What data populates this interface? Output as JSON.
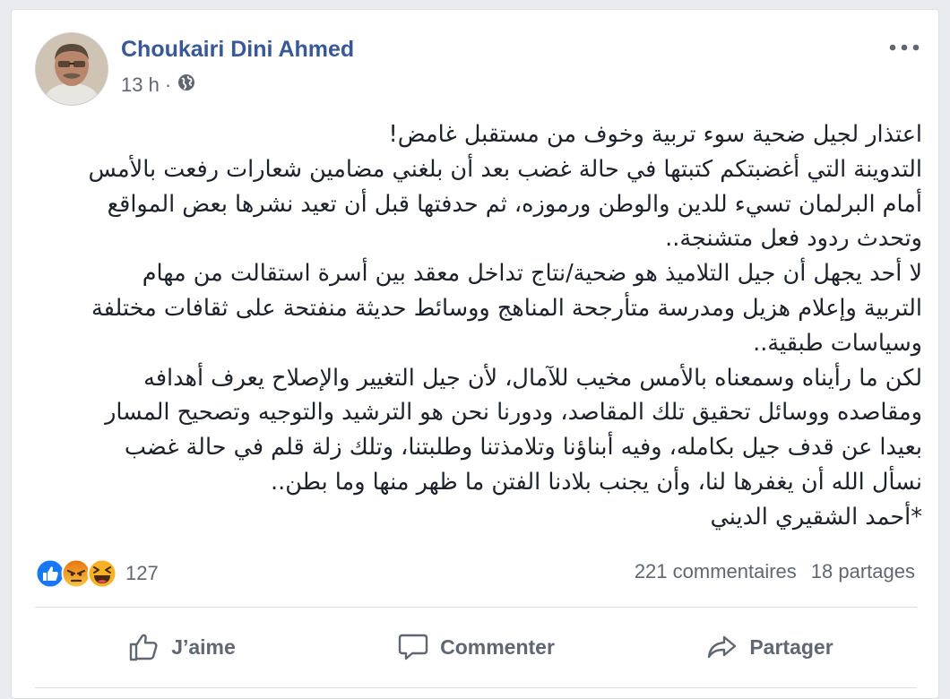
{
  "post": {
    "author": "Choukairi Dini Ahmed",
    "time": "13 h",
    "separator": "·",
    "privacy_icon": "globe-icon",
    "text_lines": [
      "اعتذار لجيل ضحية سوء تربية وخوف من مستقبل غامض!",
      "التدوينة التي أغضبتكم كتبتها في حالة غضب بعد أن بلغني مضامين شعارات رفعت بالأمس",
      "أمام البرلمان تسيء للدين والوطن ورموزه، ثم حدفتها قبل أن تعيد نشرها بعض المواقع",
      "وتحدث ردود فعل متشنجة..",
      "لا أحد يجهل أن جيل التلاميذ هو ضحية/نتاج تداخل معقد بين أسرة استقالت من مهام",
      "التربية وإعلام هزيل ومدرسة متأرجحة المناهج ووسائط حديثة منفتحة على ثقافات مختلفة",
      "وسياسات طبقية..",
      "لكن ما رأيناه وسمعناه بالأمس مخيب للآمال، لأن جيل التغيير والإصلاح يعرف أهدافه",
      "ومقاصده ووسائل تحقيق تلك المقاصد، ودورنا نحن هو الترشيد والتوجيه وتصحيح المسار",
      "بعيدا عن قدف جيل بكامله، وفيه أبناؤنا وتلامذتنا وطلبتنا، وتلك زلة قلم في حالة غضب",
      "نسأل الله أن يغفرها لنا، وأن يجنب بلادنا الفتن ما ظهر منها وما بطن..",
      "*أحمد الشقيري الديني"
    ]
  },
  "reactions": {
    "icons": [
      "like-icon",
      "angry-icon",
      "haha-icon"
    ],
    "count": "127"
  },
  "stats": {
    "comments": "221 commentaires",
    "shares": "18 partages"
  },
  "actions": {
    "like": "J’aime",
    "comment": "Commenter",
    "share": "Partager"
  },
  "colors": {
    "author": "#385898",
    "secondary_text": "#616770",
    "like_blue": "#1877f2",
    "angry_orange": "#e9710f",
    "haha_yellow": "#f7b125"
  }
}
